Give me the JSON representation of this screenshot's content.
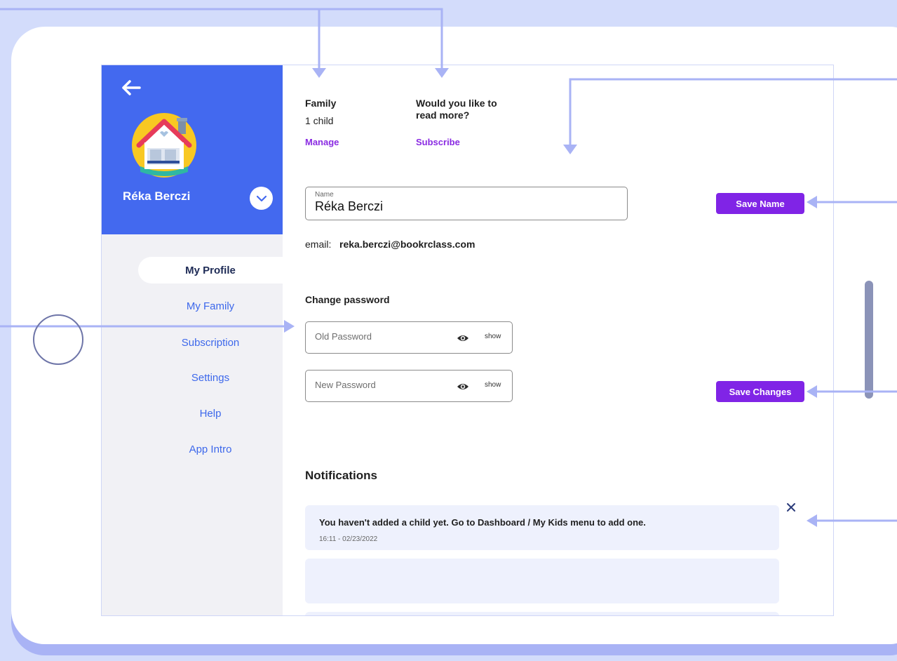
{
  "user": {
    "name": "Réka Berczi"
  },
  "icons": {
    "back": "arrow-left-icon",
    "avatar": "house-avatar-icon",
    "dropdown": "chevron-down-icon",
    "eye": "eye-icon",
    "close": "close-icon"
  },
  "sidebar": {
    "items": [
      {
        "label": "My Profile",
        "active": true
      },
      {
        "label": "My Family",
        "active": false
      },
      {
        "label": "Subscription",
        "active": false
      },
      {
        "label": "Settings",
        "active": false
      },
      {
        "label": "Help",
        "active": false
      },
      {
        "label": "App Intro",
        "active": false
      }
    ]
  },
  "family": {
    "title": "Family",
    "count": "1 child",
    "manage_label": "Manage"
  },
  "promo": {
    "title_line1": "Would you like to",
    "title_line2": "read more?",
    "subscribe_label": "Subscribe"
  },
  "profile": {
    "name_label": "Name",
    "name_value": "Réka Berczi",
    "save_name_label": "Save Name",
    "email_label": "email:",
    "email_value": "reka.berczi@bookrclass.com"
  },
  "password": {
    "heading": "Change password",
    "old_placeholder": "Old Password",
    "new_placeholder": "New Password",
    "show_label": "show",
    "save_label": "Save Changes"
  },
  "notifications": {
    "heading": "Notifications",
    "items": [
      {
        "message": "You haven't added a child yet. Go to Dashboard / My Kids menu to add one.",
        "time": "16:11 - 02/23/2022"
      }
    ]
  },
  "colors": {
    "background": "#d3dcfb",
    "sidebar_header": "#4369ef",
    "accent_purple": "#8024e6",
    "annotation": "#a9b3f5",
    "nav_text": "#3d68eb"
  }
}
